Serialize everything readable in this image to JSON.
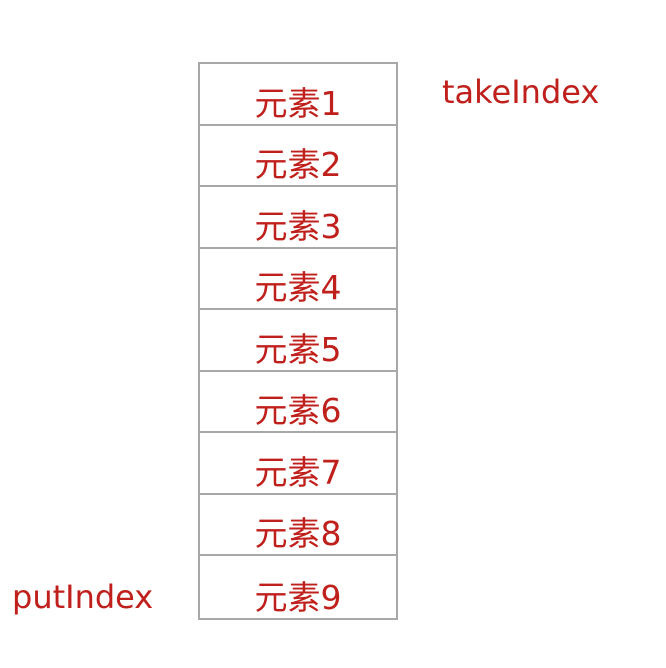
{
  "labels": {
    "take_index": "takeIndex",
    "put_index": "putIndex"
  },
  "array": {
    "cells": [
      "元素1",
      "元素2",
      "元素3",
      "元素4",
      "元素5",
      "元素6",
      "元素7",
      "元素8",
      "元素9"
    ]
  },
  "colors": {
    "text": "#c0201c",
    "border": "#a8a8a8"
  }
}
